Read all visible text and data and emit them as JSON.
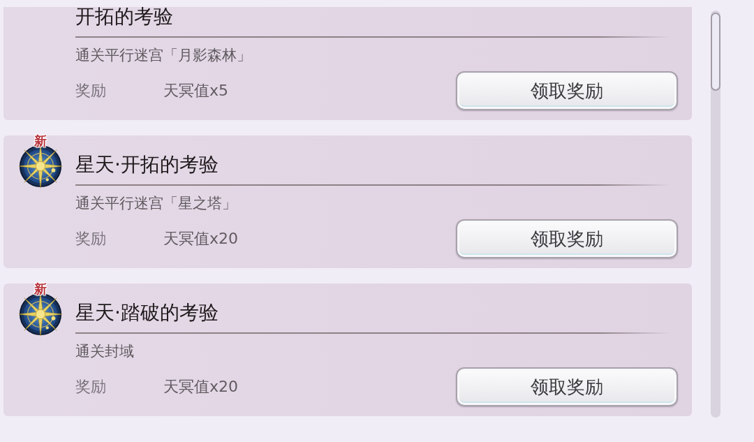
{
  "quests": [
    {
      "title": "开拓的考验",
      "description": "通关平行迷宫「月影森林」",
      "reward_label": "奖励",
      "reward": "天冥值x5",
      "button": "领取奖励"
    },
    {
      "badge": "新",
      "title": "星天·开拓的考验",
      "description": "通关平行迷宫「星之塔」",
      "reward_label": "奖励",
      "reward": "天冥值x20",
      "button": "领取奖励"
    },
    {
      "badge": "新",
      "title": "星天·踏破的考验",
      "description": "通关封域",
      "reward_label": "奖励",
      "reward": "天冥值x20",
      "button": "领取奖励"
    }
  ]
}
